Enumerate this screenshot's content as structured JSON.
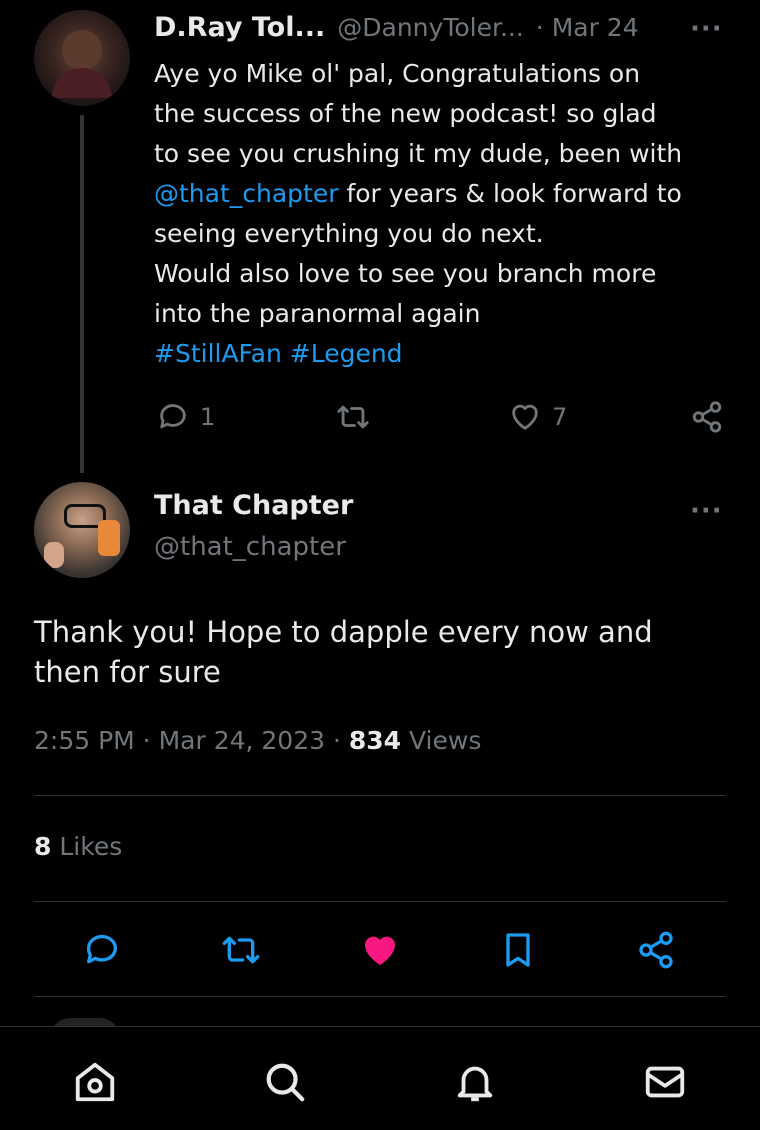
{
  "reply": {
    "display_name": "D.Ray Tol...",
    "handle": "@DannyToler...",
    "date": "· Mar 24",
    "more": "···",
    "text_lines": [
      "Aye yo Mike ol' pal, Congratulations on",
      "the success of the new podcast! so glad",
      "to see you crushing it my dude, been with"
    ],
    "mention": "@that_chapter",
    "mention_tail": " for years & look forward to",
    "text_lines2": [
      "seeing everything you do next.",
      "Would also love to see you branch more",
      "into the paranormal again"
    ],
    "hashtags": "#StillAFan #Legend",
    "reply_count": "1",
    "like_count": "7"
  },
  "main": {
    "display_name": "That Chapter",
    "handle": "@that_chapter",
    "more": "···",
    "text_line1": "Thank you! Hope to dapple every now and",
    "text_line2": "then for sure",
    "timestamp": "2:55 PM · Mar 24, 2023 · ",
    "views_count": "834",
    "views_label": " Views",
    "likes_count": "8",
    "likes_label": " Likes",
    "like_color": "#f91880"
  },
  "colors": {
    "accent": "#1d9bf0",
    "muted": "#71767b"
  }
}
